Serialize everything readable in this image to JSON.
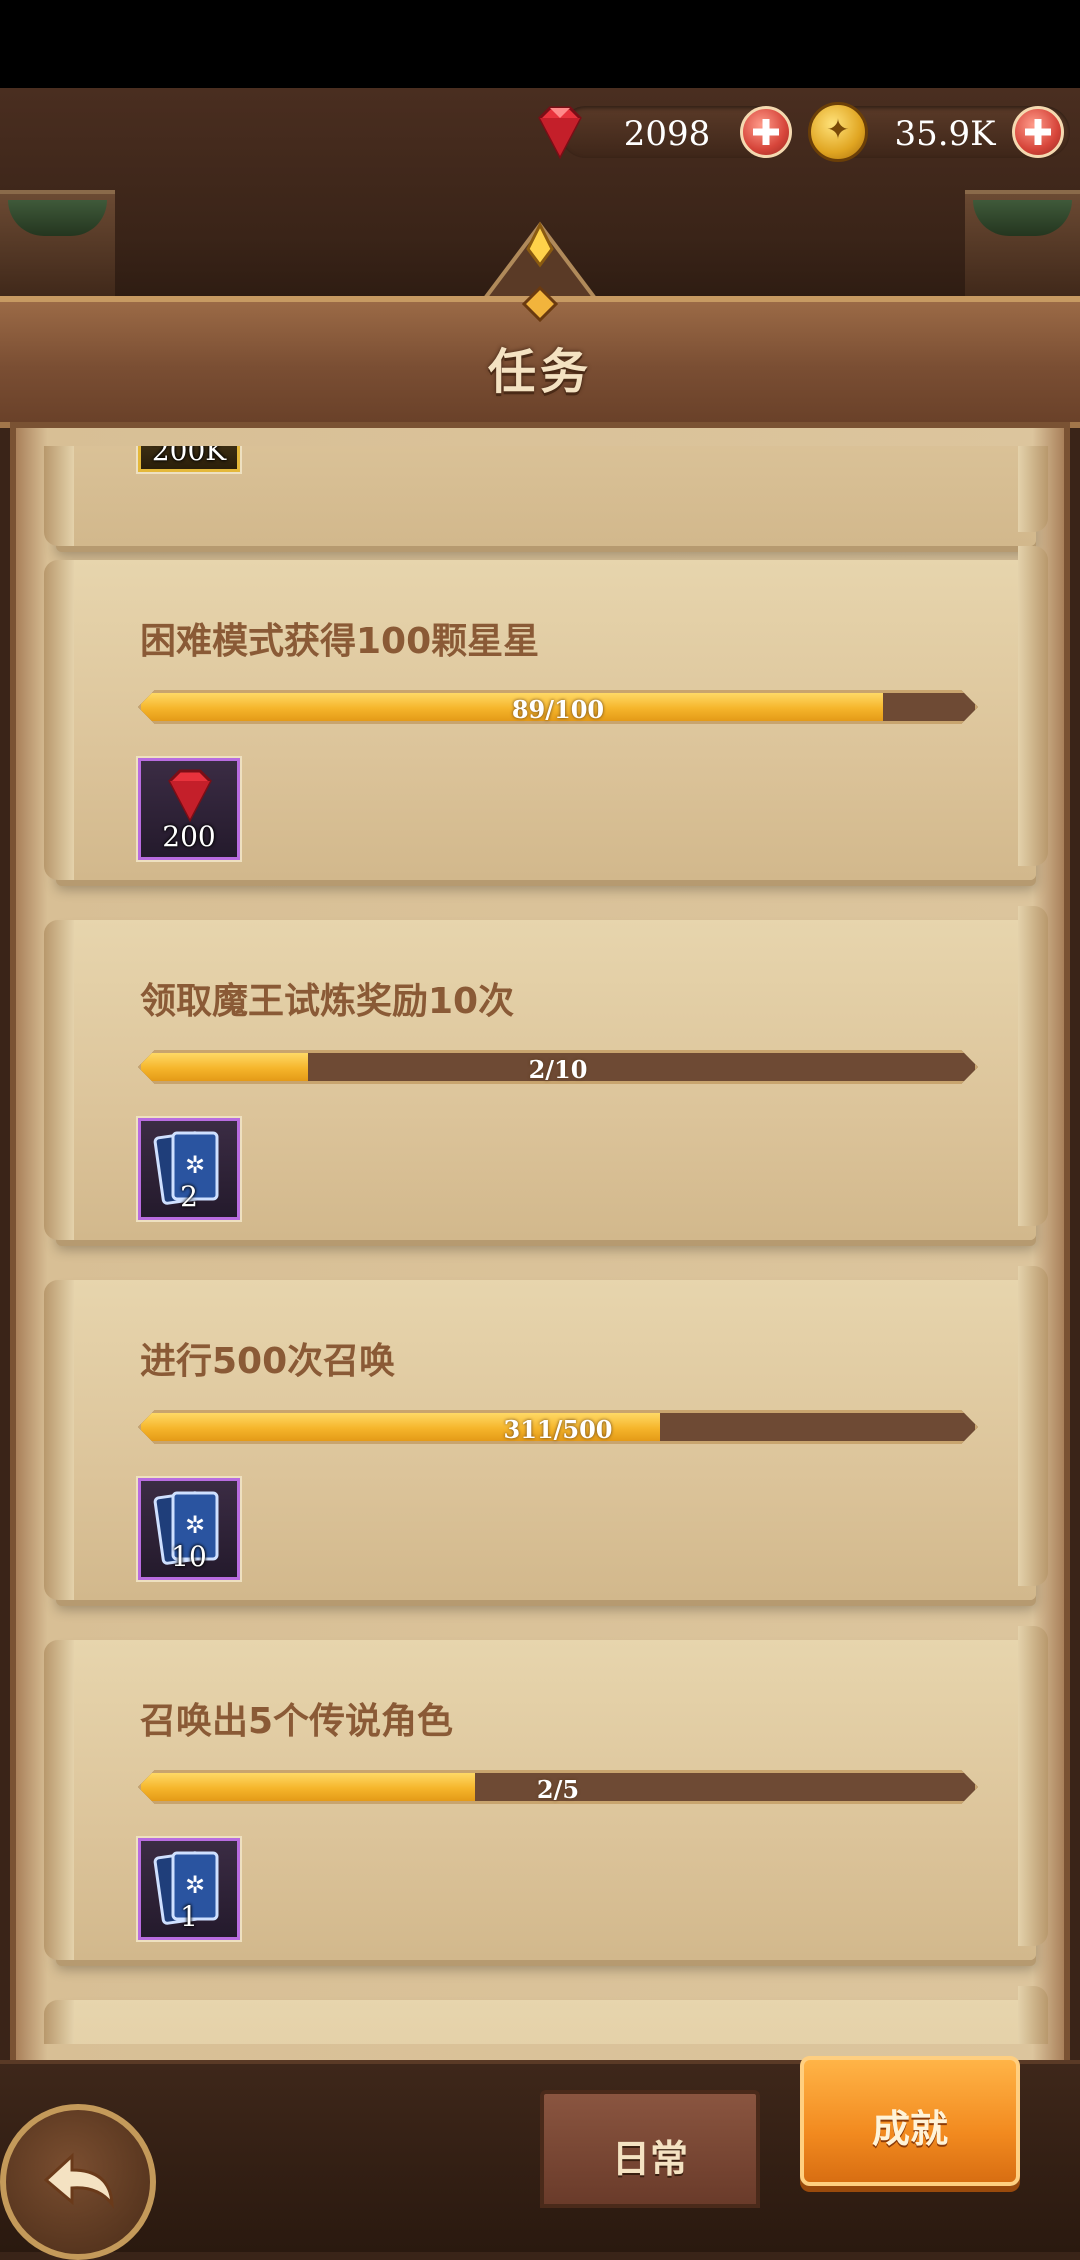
{
  "currencies": {
    "gems": {
      "value": "2098",
      "icon": "ruby-gem-icon"
    },
    "coins": {
      "value": "35.9K",
      "icon": "gold-coin-icon"
    }
  },
  "header": {
    "title": "任务"
  },
  "quests": [
    {
      "description": "",
      "progress_text": "",
      "progress": null,
      "reward": {
        "icon": "gold-coin-icon",
        "count": "200K"
      }
    },
    {
      "description": "困难模式获得100颗星星",
      "progress_text": "89/100",
      "progress": 0.89,
      "reward": {
        "icon": "ruby-gem-icon",
        "count": "200"
      }
    },
    {
      "description": "领取魔王试炼奖励10次",
      "progress_text": "2/10",
      "progress": 0.2,
      "reward": {
        "icon": "summon-card-icon",
        "count": "2"
      }
    },
    {
      "description": "进行500次召唤",
      "progress_text": "311/500",
      "progress": 0.622,
      "reward": {
        "icon": "summon-card-icon",
        "count": "10"
      }
    },
    {
      "description": "召唤出5个传说角色",
      "progress_text": "2/5",
      "progress": 0.4,
      "reward": {
        "icon": "summon-card-icon",
        "count": "1"
      }
    }
  ],
  "tabs": {
    "daily": "日常",
    "achievements": "成就",
    "active": "achievements"
  },
  "colors": {
    "accent": "#f28a1f",
    "progress_fill": "#f5b52b",
    "text": "#8a5a36"
  }
}
